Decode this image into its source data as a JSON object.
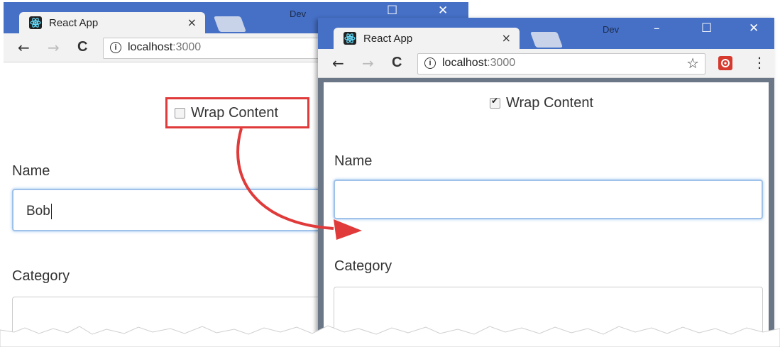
{
  "left_window": {
    "title_bar": "Dev",
    "tab": {
      "title": "React App",
      "close": "×"
    },
    "url": {
      "host": "localhost",
      "port": ":3000"
    },
    "nav": {
      "back": "←",
      "forward": "→",
      "reload": "C"
    },
    "wrap_checkbox": {
      "label": "Wrap Content",
      "checked": false
    },
    "name_label": "Name",
    "name_value": "Bob",
    "category_label": "Category"
  },
  "right_window": {
    "title_bar": "Dev",
    "controls": {
      "minimize": "–",
      "maximize": "☐",
      "close": "✕"
    },
    "tab": {
      "title": "React App",
      "close": "×"
    },
    "url": {
      "host": "localhost",
      "port": ":3000"
    },
    "nav": {
      "back": "←",
      "forward": "→",
      "reload": "C"
    },
    "toolbar_icons": {
      "star": "☆",
      "menu": "⋮"
    },
    "wrap_checkbox": {
      "label": "Wrap Content",
      "checked": true
    },
    "name_label": "Name",
    "name_value": "",
    "category_label": "Category"
  },
  "colors": {
    "titlebar": "#4670c6",
    "highlight": "#e03a3a",
    "focus": "#9fc2ea"
  },
  "icons": [
    "react-favicon-icon",
    "info-icon",
    "star-icon",
    "extension-icon",
    "menu-icon",
    "arrow-annotation"
  ]
}
